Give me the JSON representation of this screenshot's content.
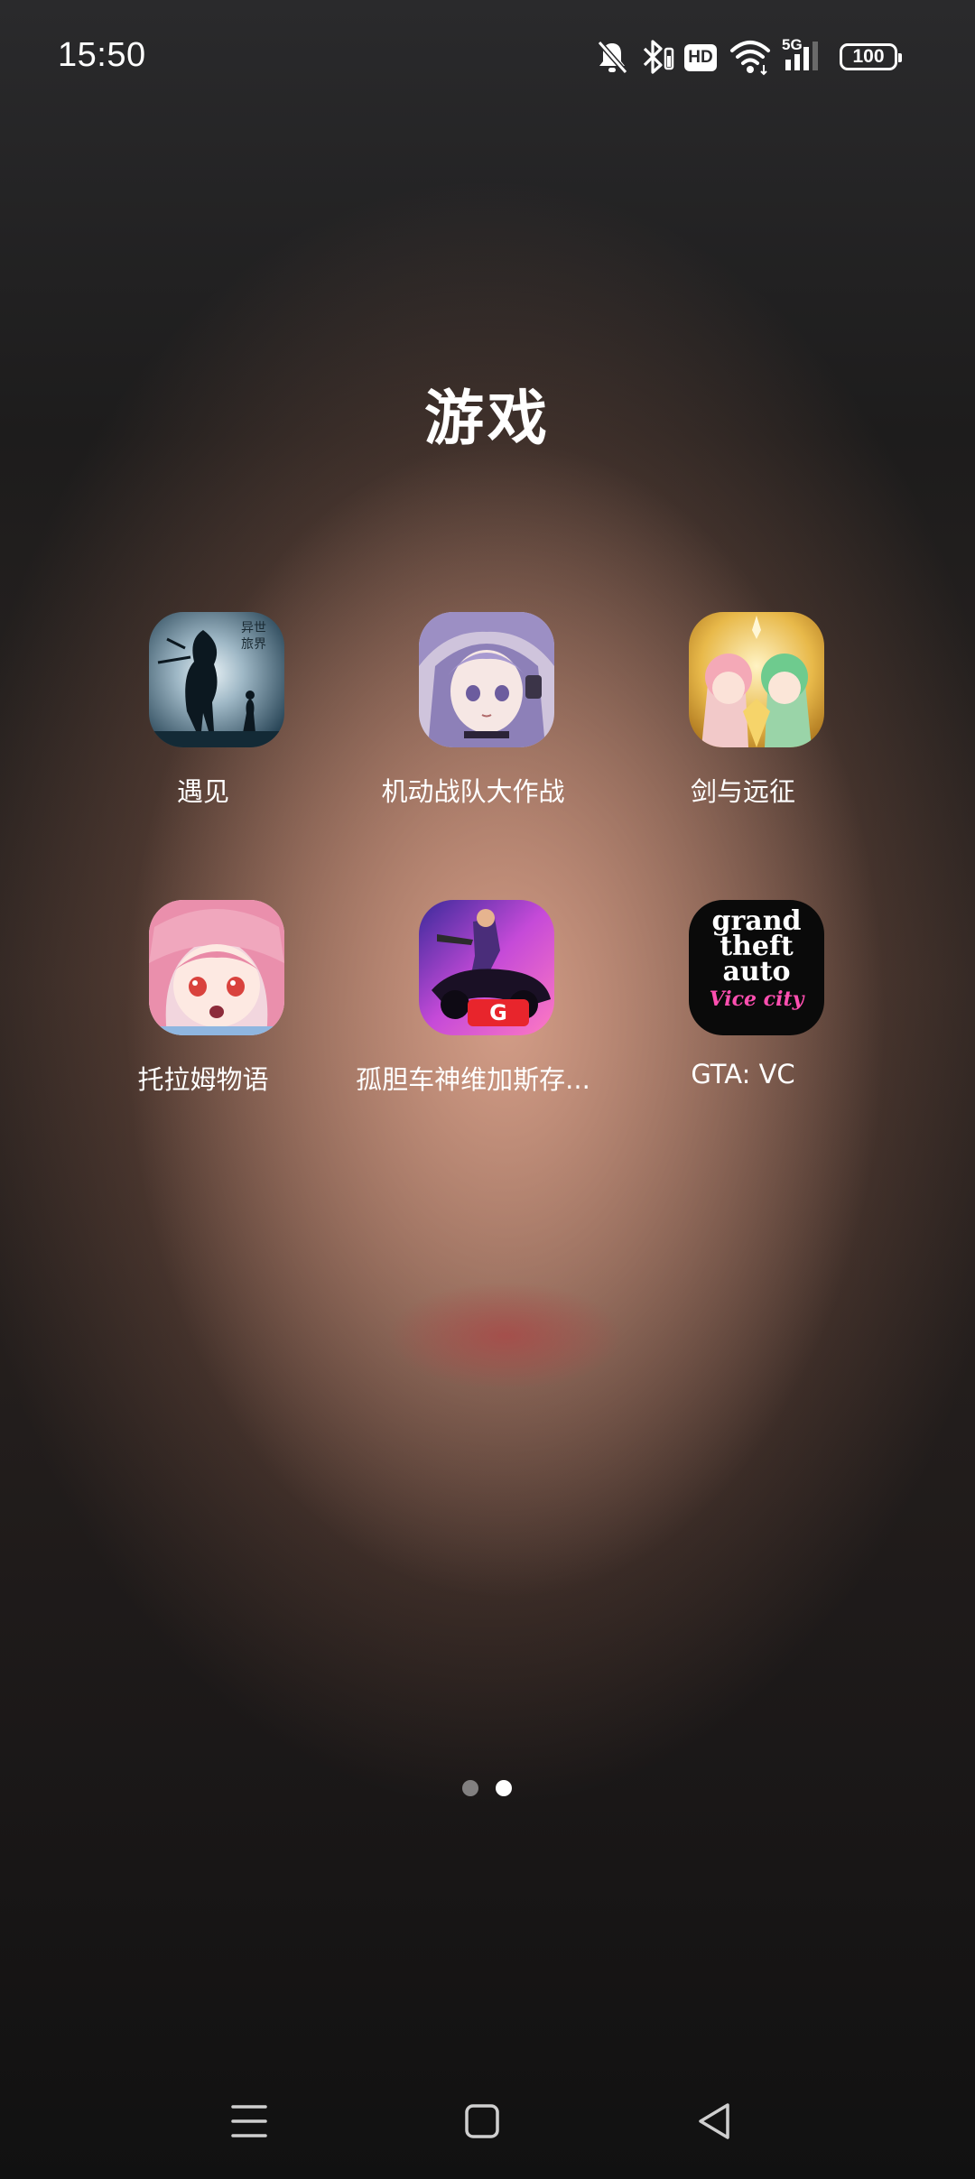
{
  "status_bar": {
    "time": "15:50",
    "icons": [
      "notifications-off-icon",
      "bluetooth-icon",
      "hd-icon",
      "wifi-icon",
      "5g-signal-icon"
    ],
    "hd_label": "HD",
    "network_label": "5G",
    "battery_level": "100"
  },
  "folder": {
    "title": "游戏"
  },
  "apps": [
    {
      "label": "遇见",
      "icon": "yujian-app-icon"
    },
    {
      "label": "机动战队大作战",
      "icon": "jidong-zhandui-app-icon"
    },
    {
      "label": "剑与远征",
      "icon": "jian-yu-yuanzheng-app-icon"
    },
    {
      "label": "托拉姆物语",
      "icon": "toram-app-icon"
    },
    {
      "label": "孤胆车神维加斯存...",
      "icon": "gangstar-vegas-app-icon"
    },
    {
      "label": "GTA: VC",
      "icon": "gta-vice-city-app-icon"
    }
  ],
  "gta_icon_text": {
    "line1": "grand",
    "line2": "theft",
    "line3": "auto",
    "line4": "Vice city"
  },
  "page_indicator": {
    "pages": 2,
    "current": 2
  },
  "nav_bar": {
    "buttons": [
      "menu-icon",
      "home-icon",
      "back-icon"
    ]
  }
}
